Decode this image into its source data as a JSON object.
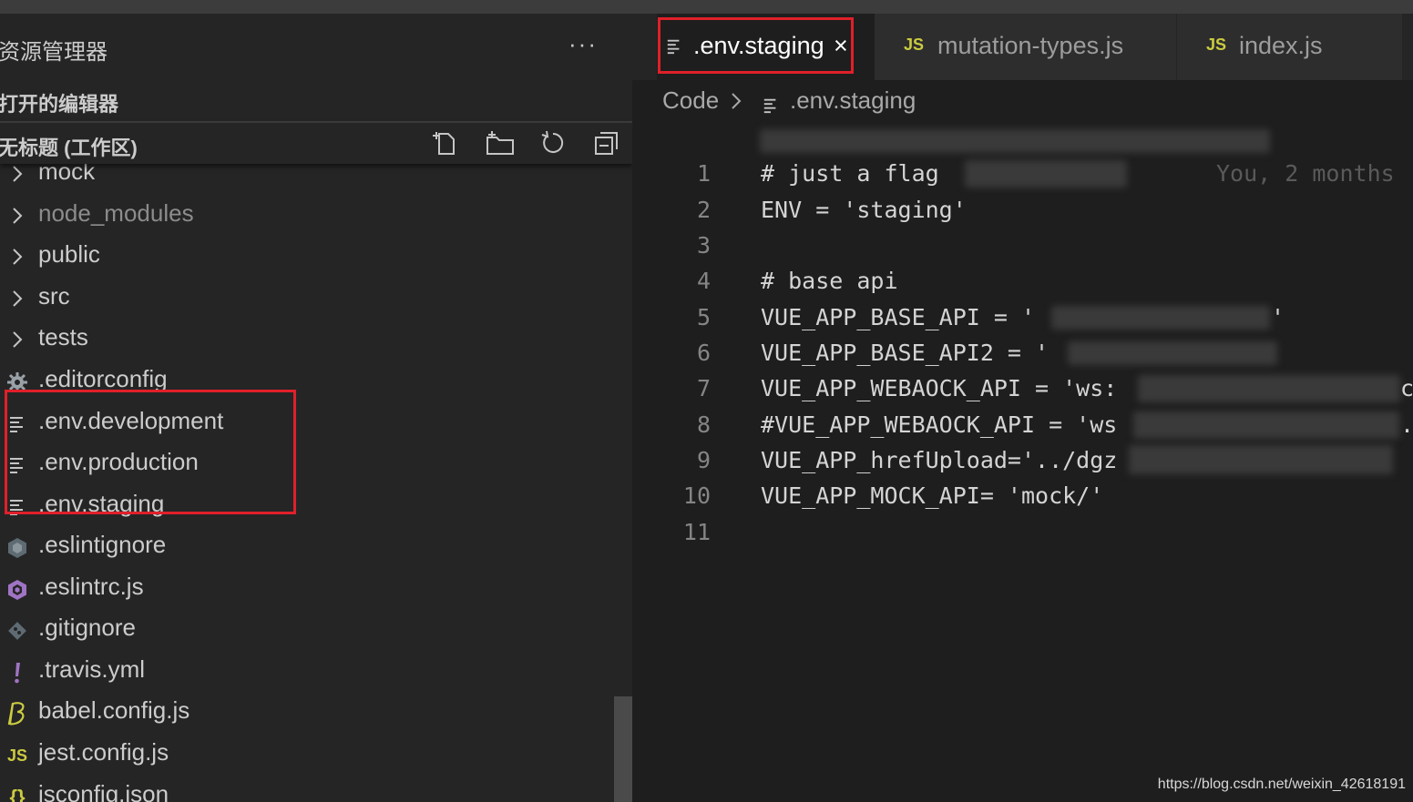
{
  "sidebar": {
    "title": "资源管理器",
    "more": "···",
    "open_editors": "打开的编辑器",
    "workspace_title": "无标题 (工作区)",
    "actions": [
      {
        "name": "new-file-icon"
      },
      {
        "name": "new-folder-icon"
      },
      {
        "name": "refresh-icon"
      },
      {
        "name": "collapse-all-icon"
      }
    ],
    "items": [
      {
        "label": "mock",
        "kind": "folder"
      },
      {
        "label": "node_modules",
        "kind": "folder",
        "dim": true
      },
      {
        "label": "public",
        "kind": "folder"
      },
      {
        "label": "src",
        "kind": "folder"
      },
      {
        "label": "tests",
        "kind": "folder"
      },
      {
        "label": ".editorconfig",
        "kind": "gear"
      },
      {
        "label": ".env.development",
        "kind": "lines"
      },
      {
        "label": ".env.production",
        "kind": "lines"
      },
      {
        "label": ".env.staging",
        "kind": "lines"
      },
      {
        "label": ".eslintignore",
        "kind": "eslint-gray"
      },
      {
        "label": ".eslintrc.js",
        "kind": "eslint"
      },
      {
        "label": ".gitignore",
        "kind": "git"
      },
      {
        "label": ".travis.yml",
        "kind": "travis"
      },
      {
        "label": "babel.config.js",
        "kind": "babel"
      },
      {
        "label": "jest.config.js",
        "kind": "js"
      },
      {
        "label": "jsconfig.json",
        "kind": "json"
      }
    ]
  },
  "tabs": [
    {
      "label": ".env.staging",
      "icon": "lines",
      "active": true,
      "close": "×"
    },
    {
      "label": "mutation-types.js",
      "icon": "js",
      "badge": "JS"
    },
    {
      "label": "index.js",
      "icon": "js",
      "badge": "JS"
    }
  ],
  "breadcrumb": {
    "root": "Code",
    "file": ".env.staging"
  },
  "editor": {
    "lines": [
      {
        "n": "1",
        "text": "# just a flag"
      },
      {
        "n": "2",
        "text": "ENV = 'staging'"
      },
      {
        "n": "3",
        "text": ""
      },
      {
        "n": "4",
        "text": "# base api"
      },
      {
        "n": "5",
        "text": "VUE_APP_BASE_API = '"
      },
      {
        "n": "6",
        "text": "VUE_APP_BASE_API2 = '"
      },
      {
        "n": "7",
        "text": "VUE_APP_WEBAOCK_API = 'ws:"
      },
      {
        "n": "8",
        "text": "#VUE_APP_WEBAOCK_API = 'ws"
      },
      {
        "n": "9",
        "text": "VUE_APP_hrefUpload='../dgz"
      },
      {
        "n": "10",
        "text": "VUE_APP_MOCK_API= 'mock/'"
      },
      {
        "n": "11",
        "text": ""
      }
    ],
    "ghost_text": "You, 2 months",
    "line5_tail": "'",
    "line7_tail": "c",
    "line8_tail": "."
  },
  "watermark": "https://blog.csdn.net/weixin_42618191",
  "colors": {
    "highlight_red": "#e0202a",
    "js_yellow": "#cbcb41",
    "eslint_purple": "#a074c4"
  }
}
